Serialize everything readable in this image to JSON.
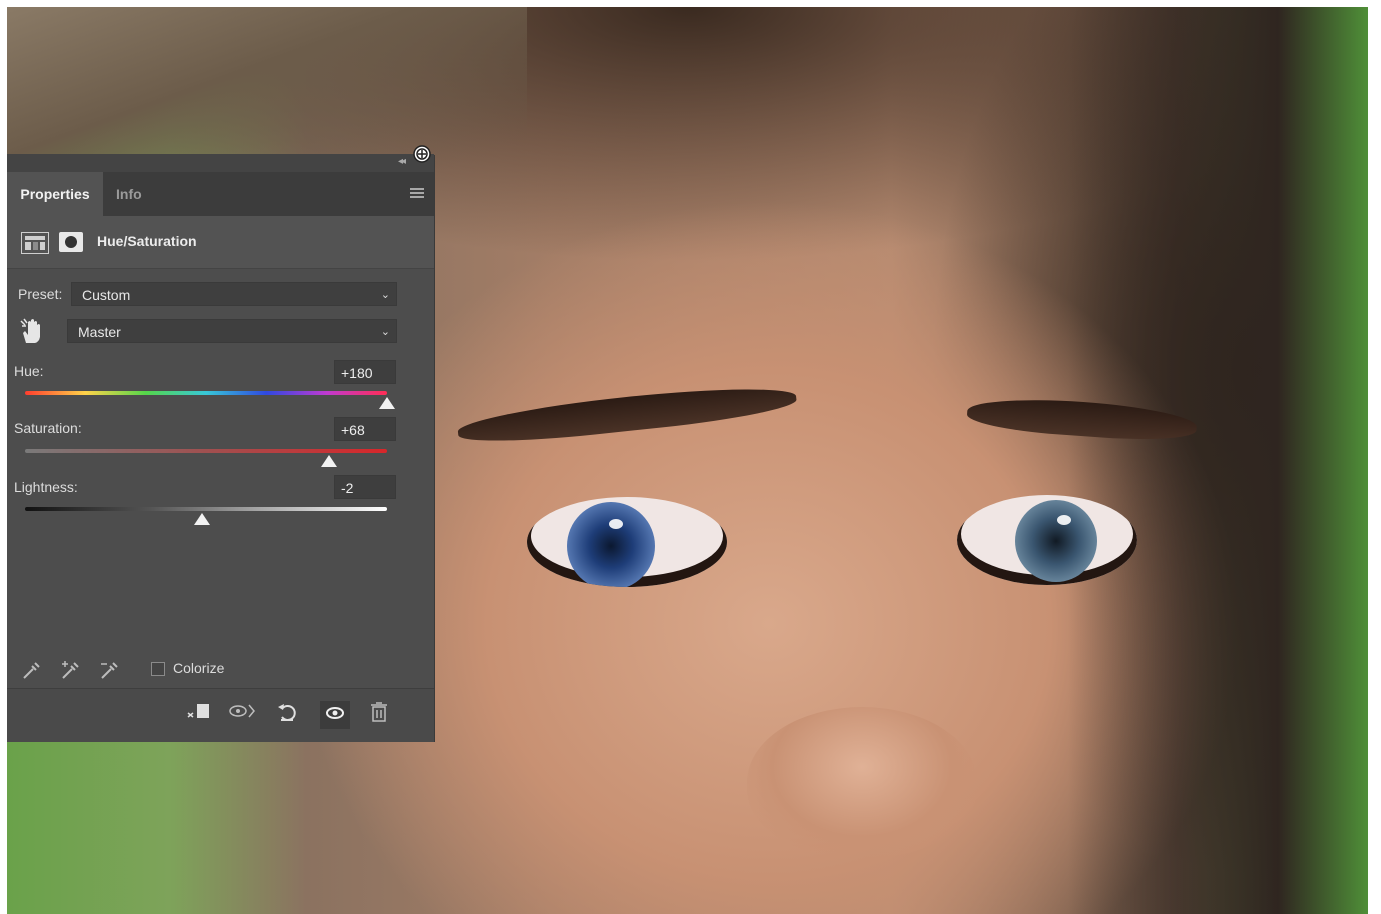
{
  "panel": {
    "tabs": [
      {
        "label": "Properties",
        "active": true
      },
      {
        "label": "Info",
        "active": false
      }
    ],
    "adjustment_title": "Hue/Saturation",
    "preset": {
      "label": "Preset:",
      "value": "Custom"
    },
    "channel": {
      "value": "Master"
    },
    "hue": {
      "label": "Hue:",
      "value": "+180",
      "position": 1.0
    },
    "saturation": {
      "label": "Saturation:",
      "value": "+68",
      "position": 0.84
    },
    "lightness": {
      "label": "Lightness:",
      "value": "-2",
      "position": 0.49
    },
    "colorize": {
      "label": "Colorize",
      "checked": false
    },
    "footer_icons": [
      "clip-to-layer-icon",
      "view-previous-state-icon",
      "reset-icon",
      "visibility-eye-icon",
      "trash-icon"
    ]
  },
  "colors": {
    "panel_bg": "#535353",
    "tab_bar": "#3c3c3c",
    "saturation_track": "#d8262a"
  }
}
